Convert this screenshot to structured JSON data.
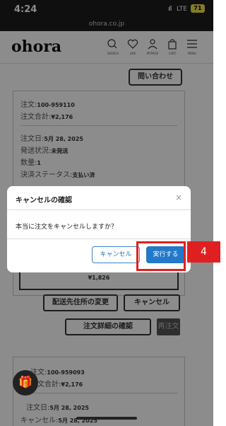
{
  "status": {
    "time": "4:24",
    "signal": "ıll",
    "network": "LTE",
    "battery": "71",
    "url": "ohora.co.jp"
  },
  "header": {
    "logo": "ohora",
    "nav": [
      {
        "icon": "search-icon",
        "label": "SEARCH"
      },
      {
        "icon": "heart-icon",
        "label": "LIKE"
      },
      {
        "icon": "user-icon",
        "label": "MYPAGE"
      },
      {
        "icon": "bag-icon",
        "label": "CART"
      },
      {
        "icon": "menu-icon",
        "label": "MENU"
      }
    ]
  },
  "contact_label": "問い合わせ",
  "order1": {
    "number_label": "注文:",
    "number": "100-959110",
    "total_label": "注文合計:",
    "total": "¥2,176",
    "date_label": "注文日:",
    "date": "5月 28, 2025",
    "ship_label": "発送状況:",
    "ship": "未発送",
    "qty_label": "数量:",
    "qty": "1",
    "pay_label": "決済ステータス:",
    "pay": "支払い済",
    "price": "¥1,826",
    "change_address": "配送先住所の変更",
    "cancel": "キャンセル",
    "detail": "注文詳細の確認",
    "reorder": "再注文"
  },
  "order2": {
    "number_label": "注文:",
    "number": "100-959093",
    "total_label": "注文合計:",
    "total": "¥2,176",
    "date_label": "注文日:",
    "date": "5月 28, 2025",
    "cancel_label": "キャンセル:",
    "cancel_date": "5月 28, 2025"
  },
  "dialog": {
    "title": "キャンセルの確認",
    "close": "×",
    "message": "本当に注文をキャンセルしますか？",
    "cancel_button": "キャンセル",
    "confirm_button": "実行する"
  },
  "annotation": {
    "step": "4"
  },
  "gift_icon": "gift-icon"
}
